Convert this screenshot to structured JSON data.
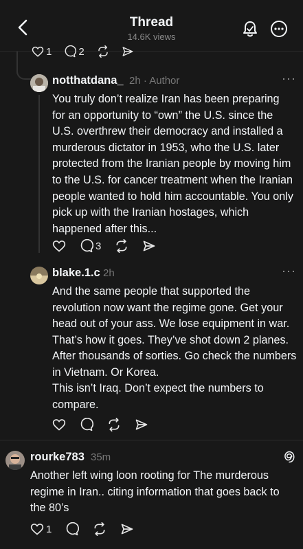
{
  "header": {
    "title": "Thread",
    "views": "14.6K views"
  },
  "prev_post_actions": {
    "likes": "1",
    "replies": "2"
  },
  "posts": [
    {
      "username": "notthatdana_",
      "time": "2h",
      "role": "· Author",
      "text": "You truly don’t realize Iran has been preparing for an opportunity to “own” the U.S. since the U.S. overthrew their democracy and installed a murderous dictator in 1953, who the U.S. later protected from the Iranian people by moving him to the U.S. for cancer treatment when the Iranian people wanted to hold him accountable. You only pick up with the Iranian hostages, which happened after this...",
      "replies": "3"
    },
    {
      "username": "blake.1.c",
      "time": "2h",
      "text1": "And the same people that supported the revolution now want the regime gone. Get your head out of your ass. We lose equipment in war. That’s how it goes. They’ve shot down 2 planes. After thousands of sorties. Go check the numbers in Vietnam. Or Korea.",
      "text2": "This isn’t Iraq. Don’t expect the numbers to compare."
    },
    {
      "username": "rourke783",
      "time": "35m",
      "text": "Another left wing loon rooting for The murderous regime in Iran.. citing information that goes back to the 80’s",
      "likes": "1"
    }
  ],
  "icons": {
    "back": "chevron-left-icon",
    "bell": "bell-icon",
    "more": "more-icon",
    "like": "heart-icon",
    "reply": "comment-icon",
    "repost": "repost-icon",
    "share": "send-icon",
    "threads": "threads-logo-icon"
  }
}
